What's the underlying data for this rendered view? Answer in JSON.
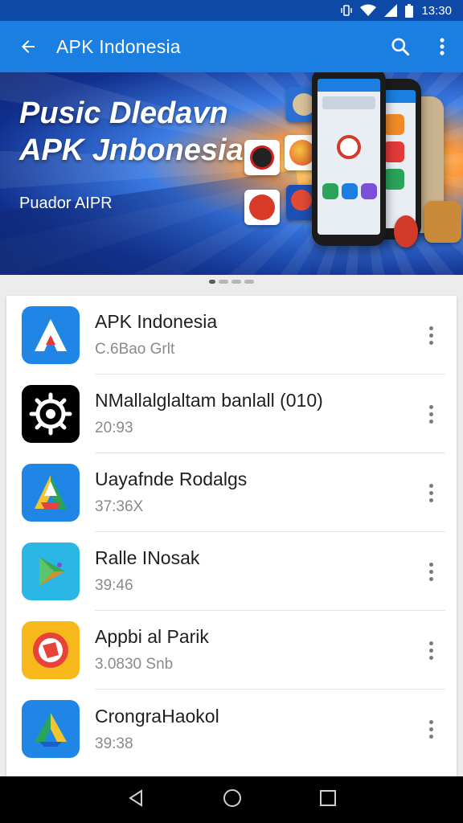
{
  "status_bar": {
    "time": "13:30",
    "icons": [
      "vibrate-icon",
      "wifi-icon",
      "signal-icon",
      "battery-icon"
    ]
  },
  "app_bar": {
    "title": "APK Indonesia",
    "icons": [
      "back-arrow-icon",
      "search-icon",
      "more-vert-icon"
    ]
  },
  "banner": {
    "title_line1": "Pusic Dledavn",
    "title_line2": "APK Jnbonesia",
    "subtitle": "Puador AIPR"
  },
  "carousel": {
    "pages": 4,
    "active_index": 0
  },
  "apps": [
    {
      "name": "APK Indonesia",
      "meta": "C.6Bao Grlt",
      "icon": "apk-logo-icon",
      "color": "#1a7fe0"
    },
    {
      "name": "NMallalglaltam banlall (010)",
      "meta": "20:93",
      "icon": "gear-wheel-icon",
      "color": "#000000"
    },
    {
      "name": "Uayafnde Rodalgs",
      "meta": "37:36X",
      "icon": "colorful-a-icon",
      "color": "#1a7fe0"
    },
    {
      "name": "Ralle INosak",
      "meta": "39:46",
      "icon": "play-triangle-icon",
      "color": "#2ab7e6"
    },
    {
      "name": "Appbi al Parik",
      "meta": "3.0830 Snb",
      "icon": "red-circle-icon",
      "color": "#f7b81c"
    },
    {
      "name": "CrongraHaokol",
      "meta": "39:38",
      "icon": "drive-triangle-icon",
      "color": "#1a7fe0"
    }
  ],
  "nav_bar": {
    "icons": [
      "nav-back-icon",
      "nav-home-icon",
      "nav-recents-icon"
    ]
  }
}
